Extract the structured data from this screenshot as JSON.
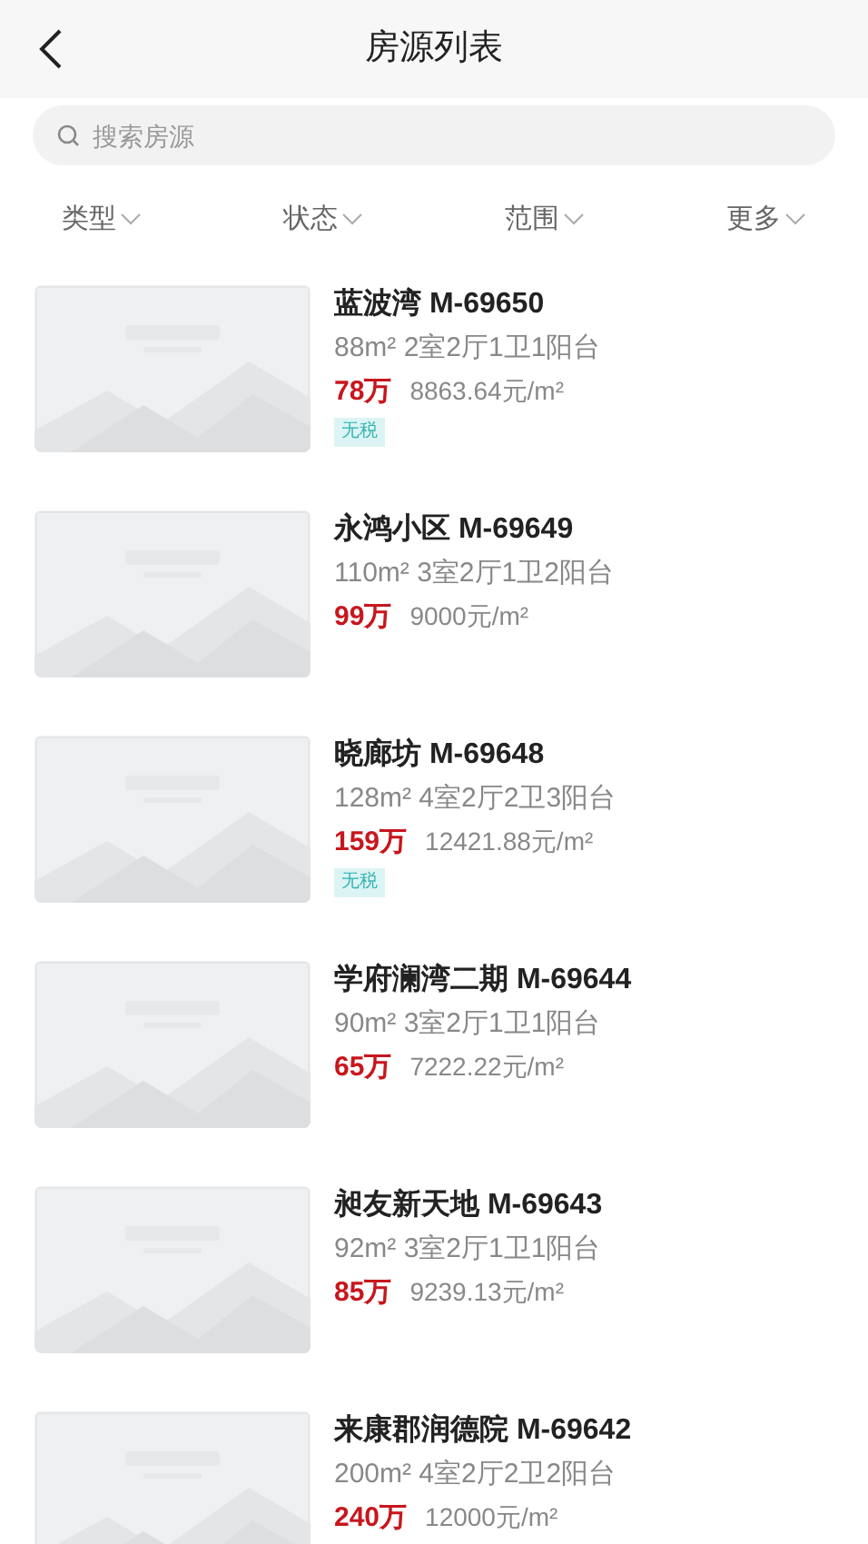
{
  "header": {
    "title": "房源列表"
  },
  "search": {
    "placeholder": "搜索房源"
  },
  "filters": [
    {
      "label": "类型"
    },
    {
      "label": "状态"
    },
    {
      "label": "范围"
    },
    {
      "label": "更多"
    }
  ],
  "listings": [
    {
      "title": "蓝波湾 M-69650",
      "specs": "88m² 2室2厅1卫1阳台",
      "price": "78万",
      "unit_price": "8863.64元/m²",
      "tags": [
        "无税"
      ]
    },
    {
      "title": "永鸿小区 M-69649",
      "specs": "110m² 3室2厅1卫2阳台",
      "price": "99万",
      "unit_price": "9000元/m²"
    },
    {
      "title": "晓廊坊 M-69648",
      "specs": "128m² 4室2厅2卫3阳台",
      "price": "159万",
      "unit_price": "12421.88元/m²",
      "tags": [
        "无税"
      ]
    },
    {
      "title": "学府澜湾二期 M-69644",
      "specs": "90m² 3室2厅1卫1阳台",
      "price": "65万",
      "unit_price": "7222.22元/m²"
    },
    {
      "title": "昶友新天地 M-69643",
      "specs": "92m² 3室2厅1卫1阳台",
      "price": "85万",
      "unit_price": "9239.13元/m²"
    },
    {
      "title": "来康郡润德院 M-69642",
      "specs": "200m² 4室2厅2卫2阳台",
      "price": "240万",
      "unit_price": "12000元/m²"
    }
  ]
}
